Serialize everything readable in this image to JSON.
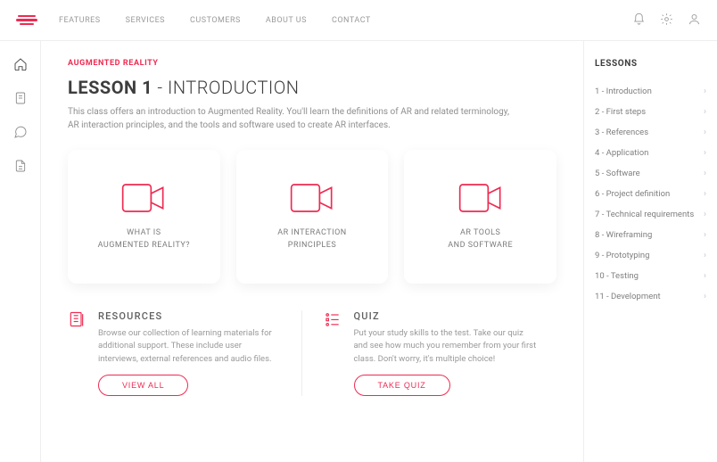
{
  "nav": {
    "links": [
      "FEATURES",
      "SERVICES",
      "CUSTOMERS",
      "ABOUT US",
      "CONTACT"
    ]
  },
  "breadcrumb": "AUGMENTED REALITY",
  "lesson": {
    "title_bold": "LESSON 1",
    "title_rest": " - INTRODUCTION",
    "description": "This class offers an introduction to Augmented Reality. You'll learn the definitions of AR and related terminology, AR interaction principles, and the tools and software used to create AR interfaces."
  },
  "cards": [
    {
      "line1": "WHAT IS",
      "line2": "AUGMENTED REALITY?"
    },
    {
      "line1": "AR INTERACTION",
      "line2": "PRINCIPLES"
    },
    {
      "line1": "AR TOOLS",
      "line2": "AND SOFTWARE"
    }
  ],
  "resources": {
    "title": "RESOURCES",
    "desc": "Browse our collection of learning materials for additional support. These include user interviews, external references and audio files.",
    "button": "VIEW ALL"
  },
  "quiz": {
    "title": "QUIZ",
    "desc": "Put your study skills to the test. Take our quiz and see how much you remember from your first class. Don't worry, it's multiple choice!",
    "button": "TAKE QUIZ"
  },
  "lessons_title": "LESSONS",
  "lessons": [
    "1 - Introduction",
    "2 - First steps",
    "3 - References",
    "4 - Application",
    "5 - Software",
    "6 - Project definition",
    "7 - Technical requirements",
    "8 - Wireframing",
    "9 - Prototyping",
    "10 - Testing",
    "11 - Development"
  ]
}
